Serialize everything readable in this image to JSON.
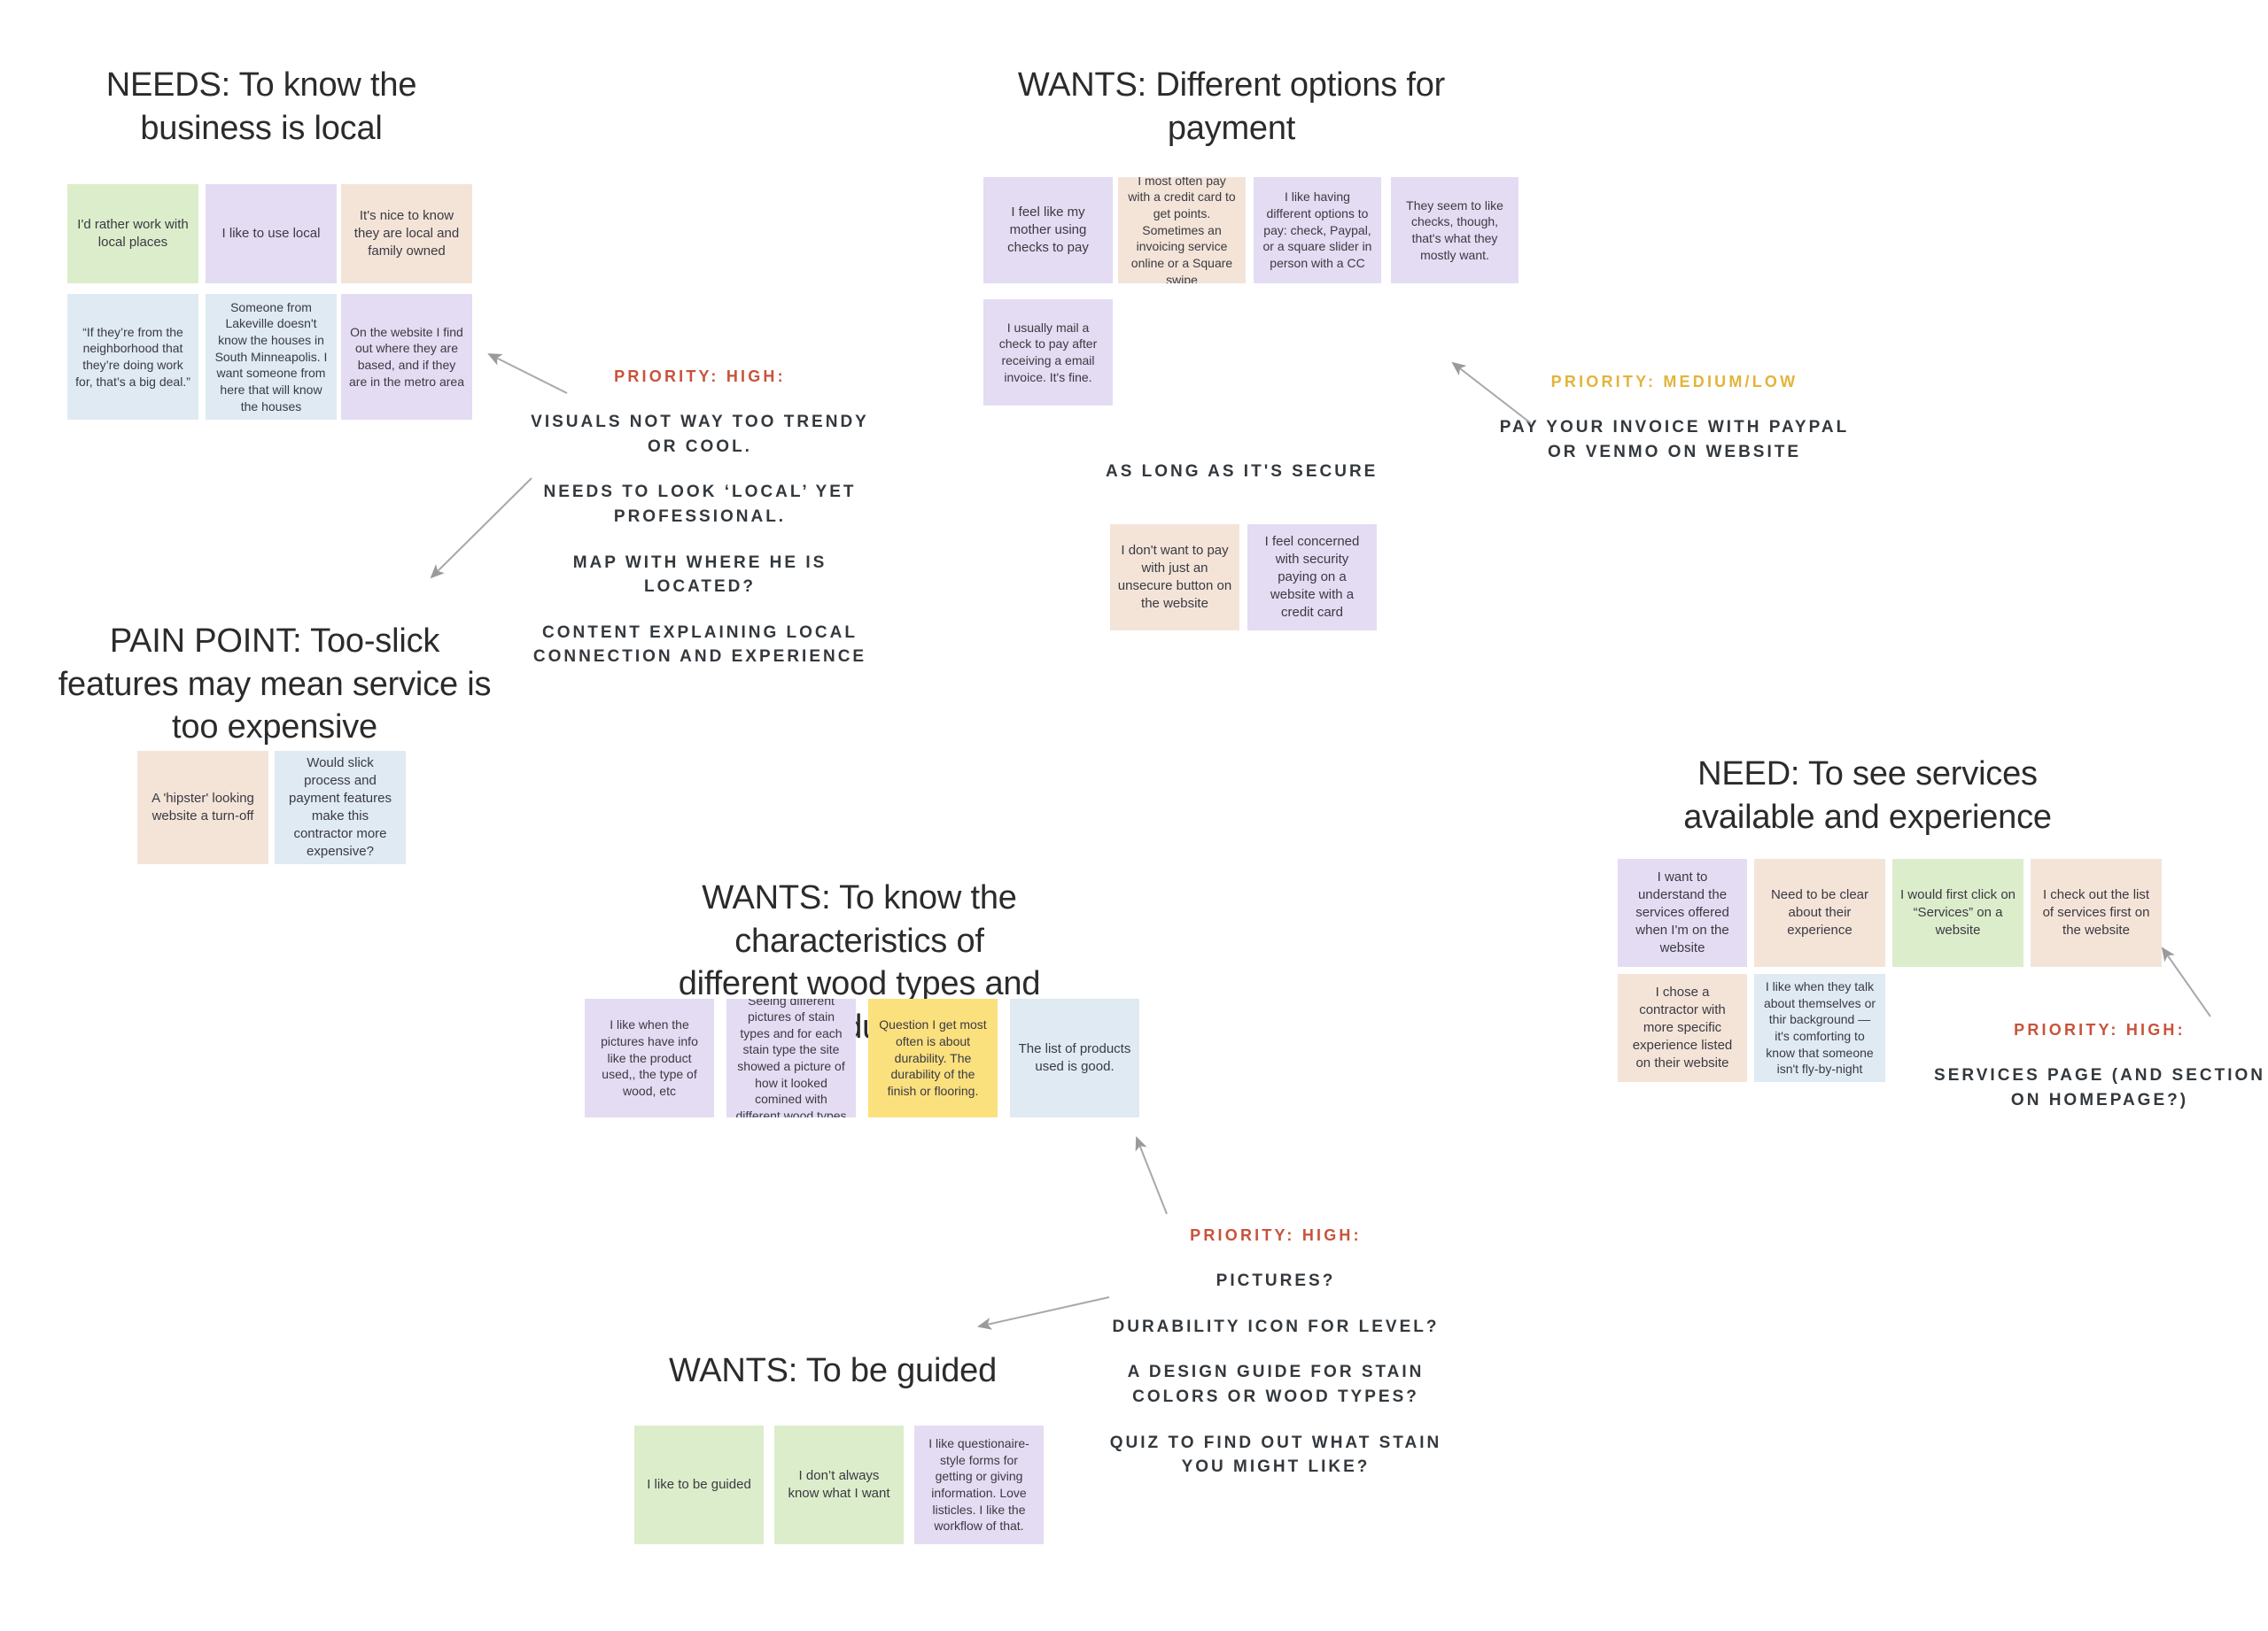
{
  "board": {
    "background": "#ffffff",
    "colors": {
      "green": "#dcedcb",
      "purple": "#e4dcf3",
      "peach": "#f4e4d8",
      "blue": "#dfeaf2",
      "yellow": "#fbe07e",
      "priority_high": "#c9523b",
      "priority_medium_low": "#e3b43a",
      "callout_text": "#33383d",
      "title_text": "#2b2b2b"
    }
  },
  "groups": [
    {
      "id": "needs-local",
      "title": "NEEDS: To know the business is local",
      "notes": [
        {
          "color": "green",
          "text": "I'd rather work with local places"
        },
        {
          "color": "purple",
          "text": "I like to use local"
        },
        {
          "color": "peach",
          "text": "It's nice to know they are local and family owned"
        },
        {
          "color": "blue",
          "text": "“If they’re from the neighborhood that they’re doing work for, that’s a big deal.”"
        },
        {
          "color": "blue",
          "text": "Someone from Lakeville doesn't know the houses in South Minneapolis. I want someone from here that will know the houses"
        },
        {
          "color": "purple",
          "text": "On the website I find out where they are based, and if they are in the metro area"
        }
      ]
    },
    {
      "id": "wants-payment",
      "title": "WANTS: Different options for payment",
      "notes": [
        {
          "color": "purple",
          "text": "I feel like my mother using checks to pay"
        },
        {
          "color": "peach",
          "text": "I most often pay with a credit card to get points. Sometimes an invoicing service online or a Square swipe"
        },
        {
          "color": "purple",
          "text": "I like having different options to pay: check, Paypal, or a square slider in person with a CC"
        },
        {
          "color": "purple",
          "text": "They seem to like checks, though, that's what they mostly want."
        },
        {
          "color": "purple",
          "text": "I usually mail a check to pay after receiving a email invoice. It's fine."
        }
      ]
    },
    {
      "id": "pain-point-slick",
      "title": "PAIN POINT: Too-slick features may mean service is too expensive",
      "notes": [
        {
          "color": "peach",
          "text": "A 'hipster' looking website a turn-off"
        },
        {
          "color": "blue",
          "text": "Would slick process and payment features make this contractor more expensive?"
        }
      ]
    },
    {
      "id": "secure-payment",
      "title": "AS LONG AS IT'S SECURE",
      "notes": [
        {
          "color": "peach",
          "text": "I don't want to pay with just an unsecure button on the website"
        },
        {
          "color": "purple",
          "text": "I feel concerned with security paying on a website with a credit card"
        }
      ]
    },
    {
      "id": "need-services",
      "title": "NEED: To see services available and experience",
      "notes": [
        {
          "color": "purple",
          "text": "I want to understand the services offered when I'm on the website"
        },
        {
          "color": "peach",
          "text": "Need to be clear about their experience"
        },
        {
          "color": "green",
          "text": "I would first click on “Services” on a website"
        },
        {
          "color": "peach",
          "text": "I check out the list of services first on the website"
        },
        {
          "color": "peach",
          "text": "I chose a contractor with more specific experience listed on their website"
        },
        {
          "color": "blue",
          "text": "I like when they talk about themselves or thir background — it's comforting to know that someone isn't fly-by-night"
        }
      ]
    },
    {
      "id": "wants-wood-types",
      "title": "WANTS: To know the characteristics of different wood types and products",
      "notes": [
        {
          "color": "purple",
          "text": "I like when the pictures have info like the product used,, the type of wood, etc"
        },
        {
          "color": "purple",
          "text": "Seeing different pictures of stain types and for each stain type the site showed a picture of how it looked comined with different wood types"
        },
        {
          "color": "yellow",
          "text": "Question I get most often is about durability. The durability of the finish or flooring."
        },
        {
          "color": "blue",
          "text": "The list of products used is good."
        }
      ]
    },
    {
      "id": "wants-guided",
      "title": "WANTS: To be guided",
      "notes": [
        {
          "color": "green",
          "text": "I like to be guided"
        },
        {
          "color": "green",
          "text": "I don’t always know what I want"
        },
        {
          "color": "purple",
          "text": "I like questionaire-style forms for getting or giving information. Love listicles. I like the workflow of that."
        }
      ]
    }
  ],
  "callouts": [
    {
      "id": "callout-local",
      "priority_label": "PRIORITY: HIGH:",
      "priority_level": "high",
      "lines": [
        "VISUALS NOT WAY TOO TRENDY OR COOL.",
        "NEEDS TO LOOK ‘LOCAL’ YET PROFESSIONAL.",
        "MAP WITH WHERE HE IS LOCATED?",
        "CONTENT EXPLAINING LOCAL CONNECTION AND EXPERIENCE"
      ]
    },
    {
      "id": "callout-payment",
      "priority_label": "PRIORITY: MEDIUM/LOW",
      "priority_level": "medium-low",
      "lines": [
        "PAY YOUR INVOICE WITH PAYPAL OR VENMO ON WEBSITE"
      ]
    },
    {
      "id": "callout-services",
      "priority_label": "PRIORITY: HIGH:",
      "priority_level": "high",
      "lines": [
        "SERVICES PAGE (AND SECTION ON HOMEPAGE?)"
      ]
    },
    {
      "id": "callout-wood",
      "priority_label": "PRIORITY: HIGH:",
      "priority_level": "high",
      "lines": [
        "PICTURES?",
        "DURABILITY ICON FOR LEVEL?",
        "A DESIGN GUIDE FOR STAIN COLORS OR WOOD TYPES?",
        "QUIZ TO FIND OUT WHAT STAIN YOU MIGHT LIKE?"
      ]
    }
  ]
}
